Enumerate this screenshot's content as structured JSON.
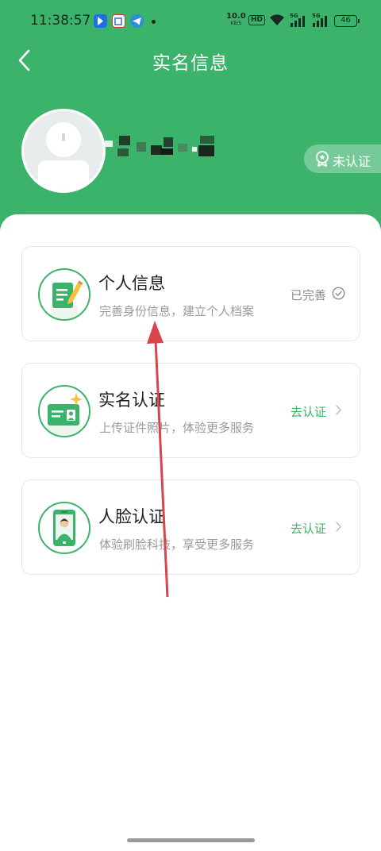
{
  "status_bar": {
    "time": "11:38:57",
    "net_speed": "10.0",
    "net_speed_unit": "KB/S",
    "hd_label": "HD",
    "signal1_label": "5G",
    "signal2_label": "5G",
    "battery": "46",
    "icons": [
      "app-notification-icon",
      "app-notification-icon",
      "telegram-icon",
      "wifi-icon",
      "signal-icon",
      "signal-icon",
      "battery-icon"
    ]
  },
  "nav": {
    "title": "实名信息",
    "back_icon": "back-chevron-icon"
  },
  "profile": {
    "certification_status": "未认证",
    "certification_icon": "award-badge-icon"
  },
  "cards": [
    {
      "title": "个人信息",
      "subtitle": "完善身份信息，建立个人档案",
      "status": "已完善",
      "status_icon": "check-circle-icon",
      "icon": "edit-document-icon"
    },
    {
      "title": "实名认证",
      "subtitle": "上传证件照片，体验更多服务",
      "status": "去认证",
      "status_icon": "chevron-right-icon",
      "icon": "id-card-icon"
    },
    {
      "title": "人脸认证",
      "subtitle": "体验刷脸科技，享受更多服务",
      "status": "去认证",
      "status_icon": "chevron-right-icon",
      "icon": "face-phone-icon"
    }
  ],
  "colors": {
    "brand_green": "#3bb36a",
    "annotation_arrow": "#d9454c"
  }
}
